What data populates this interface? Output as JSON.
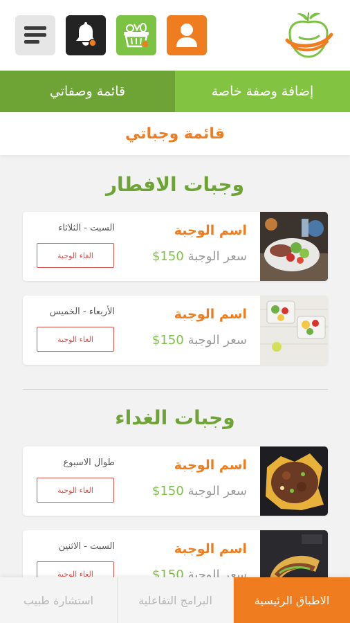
{
  "header": {
    "icons": [
      "menu-icon",
      "bell-icon",
      "basket-icon",
      "user-icon",
      "apple-logo"
    ],
    "colors": {
      "green": "#7cc243",
      "orange": "#ef7d1f",
      "dark": "#232323"
    }
  },
  "tabs": {
    "list_label": "قائمة وصفاتي",
    "add_label": "إضافة وصفة خاصة"
  },
  "page_title": "قائمة وجباتي",
  "sections": [
    {
      "title": "وجبات الافطار",
      "meals": [
        {
          "name": "اسم الوجبة",
          "price_label": "سعر الوجبة",
          "price": "150$",
          "days": "السبت - الثلاثاء",
          "cancel_label": "الغاء الوجبة"
        },
        {
          "name": "اسم الوجبة",
          "price_label": "سعر الوجبة",
          "price": "150$",
          "days": "الأربعاء - الخميس",
          "cancel_label": "الغاء الوجبة"
        }
      ]
    },
    {
      "title": "وجبات الغداء",
      "meals": [
        {
          "name": "اسم الوجبة",
          "price_label": "سعر الوجبة",
          "price": "150$",
          "days": "طوال الاسبوع",
          "cancel_label": "الغاء الوجبة"
        },
        {
          "name": "اسم الوجبة",
          "price_label": "سعر الوجبة",
          "price": "150$",
          "days": "السبت - الاثنين",
          "cancel_label": "الغاء الوجبة"
        }
      ]
    }
  ],
  "bottom_nav": {
    "main": "الاطباق الرئيسية",
    "programs": "البرامج التفاعلية",
    "doctor": "استشارة طبيب"
  }
}
